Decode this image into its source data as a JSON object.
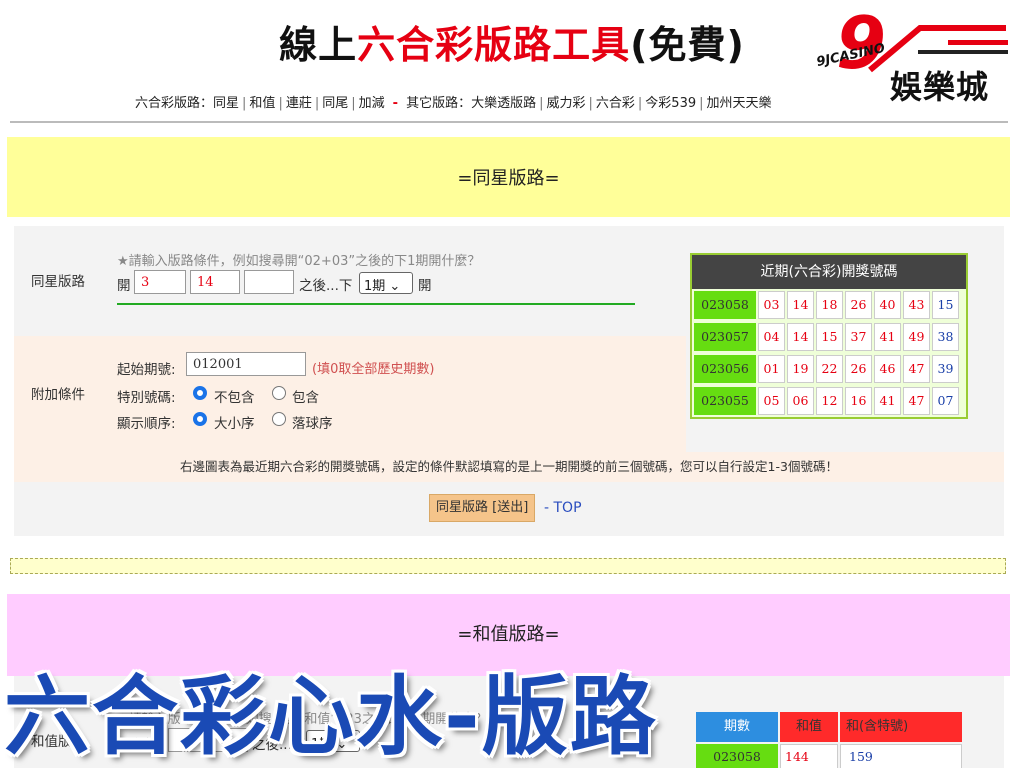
{
  "header": {
    "title_part1": "線上",
    "title_part2": "六合彩版路工具",
    "title_part3": "(免費)",
    "logo_brand": "9JCASINO",
    "logo_text": "娛樂城",
    "nav": {
      "group1_label": "六合彩版路：",
      "group1_items": [
        "同星",
        "和值",
        "連莊",
        "同尾",
        "加減"
      ],
      "separator": "-",
      "group2_label": "其它版路：",
      "group2_items": [
        "大樂透版路",
        "威力彩",
        "六合彩",
        "今彩539",
        "加州天天樂"
      ]
    }
  },
  "section1": {
    "banner": "=同星版路=",
    "row1_label": "同星版路",
    "row1_hint": "★請輸入版路條件，例如搜尋開“02+03”之後的下1期開什麼？",
    "open_label": "開",
    "input1": "3",
    "input2": "14",
    "input3": "",
    "after_label": "之後...下",
    "period_select": "1期",
    "open_label2": "開",
    "row2_label": "附加條件",
    "start_label": "起始期號:",
    "start_value": "012001",
    "start_hint": "(填0取全部歷史期數)",
    "special_label": "特別號碼:",
    "special_opt1": "不包含",
    "special_opt2": "包含",
    "order_label": "顯示順序:",
    "order_opt1": "大小序",
    "order_opt2": "落球序",
    "note": "右邊圖表為最近期六合彩的開獎號碼，設定的條件默認填寫的是上一期開獎的前三個號碼，您可以自行設定1-3個號碼！",
    "submit_label": "同星版路 [送出]",
    "top_link": "- TOP",
    "recent_title": "近期(六合彩)開獎號碼",
    "recent_draws": [
      {
        "period": "023058",
        "nums": [
          "03",
          "14",
          "18",
          "26",
          "40",
          "43"
        ],
        "special": "15"
      },
      {
        "period": "023057",
        "nums": [
          "04",
          "14",
          "15",
          "37",
          "41",
          "49"
        ],
        "special": "38"
      },
      {
        "period": "023056",
        "nums": [
          "01",
          "19",
          "22",
          "26",
          "46",
          "47"
        ],
        "special": "39"
      },
      {
        "period": "023055",
        "nums": [
          "05",
          "06",
          "12",
          "16",
          "41",
          "47"
        ],
        "special": "07"
      }
    ]
  },
  "section2": {
    "banner": "=和值版路=",
    "row_label": "和值版路",
    "hint": "★請輸入版路條件，例如搜尋開“和值”123之後的下1期開什麼？",
    "open_label": "開和值",
    "input_value": "",
    "after_label": "之後...下",
    "period_select": "1期",
    "table_head": [
      "期數",
      "和值",
      "和(含特號)"
    ],
    "table_rows": [
      {
        "period": "023058",
        "sum": "144",
        "sum_special": "159"
      }
    ]
  },
  "overlay": {
    "title": "六合彩心水-版路"
  }
}
